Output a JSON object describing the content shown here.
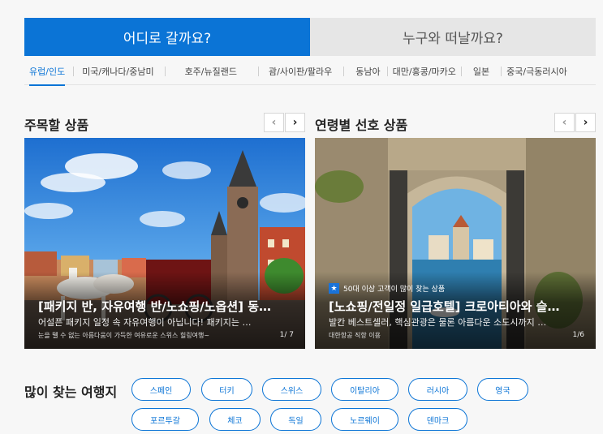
{
  "main_tabs": [
    {
      "label": "어디로 갈까요?",
      "active": true
    },
    {
      "label": "누구와 떠날까요?",
      "active": false
    }
  ],
  "regions": [
    {
      "label": "유럽/인도",
      "active": true
    },
    {
      "label": "미국/캐나다/중남미"
    },
    {
      "label": "호주/뉴질랜드"
    },
    {
      "label": "괌/사이판/팔라우"
    },
    {
      "label": "동남아"
    },
    {
      "label": "대만/홍콩/마카오"
    },
    {
      "label": "일본"
    },
    {
      "label": "중국/극동러시아"
    }
  ],
  "featured": {
    "title": "주목할 상품",
    "prev": "‹",
    "next": "›",
    "card": {
      "title": "[패키지 반, 자유여행 반/노쇼핑/노옵션] 동…",
      "desc": "어설픈 패키지 일정 속 자유여행이 아닙니다! 패키지는 …",
      "sub": "눈을 뗄 수 없는 아름다움이 가득한 여유로운 스위스 힐링여행~",
      "page": "1/ 7"
    }
  },
  "age_pref": {
    "title": "연령별 선호 상품",
    "prev": "‹",
    "next": "›",
    "card": {
      "badge": "50대 이상 고객이 많이 찾는 상품",
      "title": "[노쇼핑/전일정 일급호텔] 크로아티아와 슬…",
      "desc": "발칸 베스트셀러, 핵심관광은 물론 아름다운 소도시까지 …",
      "sub": "대한항공 직항 이용",
      "page": "1/6"
    }
  },
  "destinations": {
    "title": "많이 찾는 여행지",
    "chips": [
      "스페인",
      "터키",
      "스위스",
      "이탈리아",
      "러시아",
      "영국",
      "포르투갈",
      "체코",
      "독일",
      "노르웨이",
      "덴마크"
    ]
  },
  "colors": {
    "accent": "#0b74d6",
    "inactive_tab": "#e6e6e6"
  }
}
